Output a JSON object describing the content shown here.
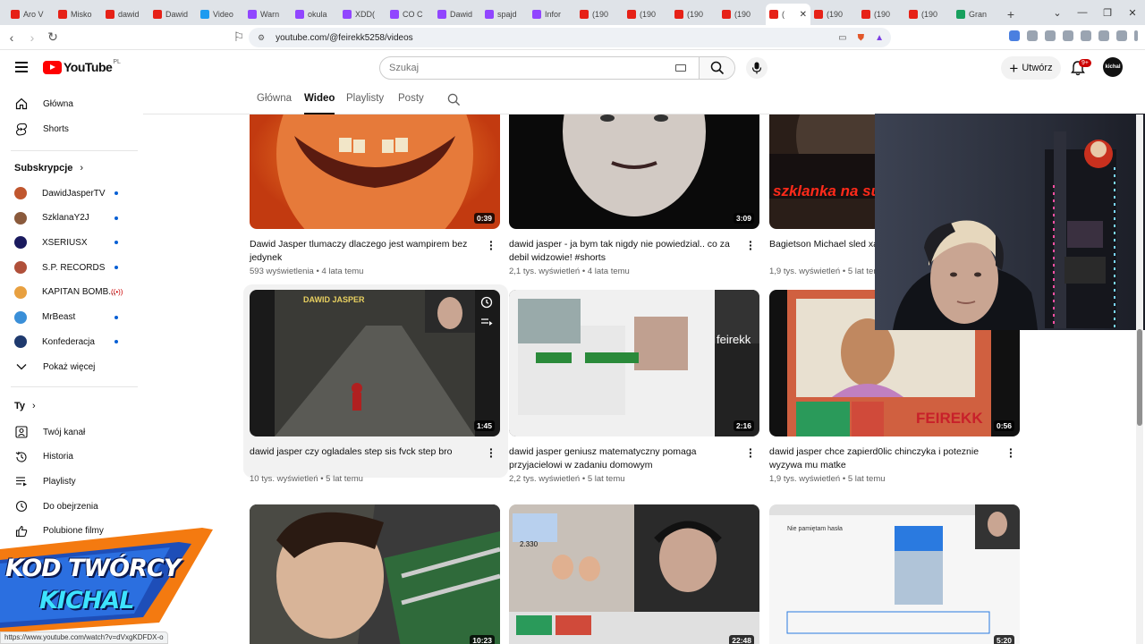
{
  "browser": {
    "tabs": [
      {
        "label": "Aro V",
        "color": "#e62117"
      },
      {
        "label": "Misko",
        "color": "#e62117"
      },
      {
        "label": "dawid",
        "color": "#e62117"
      },
      {
        "label": "Dawid",
        "color": "#e62117"
      },
      {
        "label": "Video",
        "color": "#1d9bf0"
      },
      {
        "label": "Warn",
        "color": "#9146ff"
      },
      {
        "label": "okula",
        "color": "#9146ff"
      },
      {
        "label": "XDD(",
        "color": "#9146ff"
      },
      {
        "label": "CO C",
        "color": "#9146ff"
      },
      {
        "label": "Dawid",
        "color": "#9146ff"
      },
      {
        "label": "spajd",
        "color": "#9146ff"
      },
      {
        "label": "Infor",
        "color": "#9146ff"
      },
      {
        "label": "(190",
        "color": "#e62117"
      },
      {
        "label": "(190",
        "color": "#e62117"
      },
      {
        "label": "(190",
        "color": "#e62117"
      },
      {
        "label": "(190",
        "color": "#e62117"
      },
      {
        "label": "(",
        "color": "#e62117",
        "active": true
      },
      {
        "label": "(190",
        "color": "#e62117"
      },
      {
        "label": "(190",
        "color": "#e62117"
      },
      {
        "label": "(190",
        "color": "#e62117"
      },
      {
        "label": "Gran",
        "color": "#18a05e"
      }
    ],
    "url": "youtube.com/@feirekk5258/videos",
    "status_url": "https://www.youtube.com/watch?v=dVxgKDFDX-o"
  },
  "masthead": {
    "logo_text": "YouTube",
    "country_code": "PL",
    "search_placeholder": "Szukaj",
    "create_label": "Utwórz",
    "notifications_badge": "9+",
    "avatar_label": "kichal"
  },
  "sidebar": {
    "main": [
      {
        "label": "Główna",
        "icon": "home-icon"
      },
      {
        "label": "Shorts",
        "icon": "shorts-icon"
      }
    ],
    "subscriptions_heading": "Subskrypcje",
    "subscriptions": [
      {
        "label": "DawidJasperTV",
        "color": "#c0562e",
        "indicator": "dot"
      },
      {
        "label": "SzklanaY2J",
        "color": "#8a5a3c",
        "indicator": "dot"
      },
      {
        "label": "XSERIUSX",
        "color": "#1a1a5e",
        "indicator": "dot"
      },
      {
        "label": "S.P. RECORDS",
        "color": "#b0503a",
        "indicator": "dot"
      },
      {
        "label": "KAPITAN BOMB...",
        "color": "#e8a040",
        "indicator": "live"
      },
      {
        "label": "MrBeast",
        "color": "#3a8fd8",
        "indicator": "dot"
      },
      {
        "label": "Konfederacja",
        "color": "#1f3a6e",
        "indicator": "dot"
      }
    ],
    "show_more": "Pokaż więcej",
    "you_heading": "Ty",
    "you_items": [
      {
        "label": "Twój kanał",
        "icon": "user-icon"
      },
      {
        "label": "Historia",
        "icon": "history-icon"
      },
      {
        "label": "Playlisty",
        "icon": "playlist-icon"
      },
      {
        "label": "Do obejrzenia",
        "icon": "clock-icon"
      },
      {
        "label": "Polubione filmy",
        "icon": "like-icon"
      }
    ]
  },
  "channel_tabs": [
    {
      "label": "Główna"
    },
    {
      "label": "Wideo",
      "selected": true
    },
    {
      "label": "Playlisty"
    },
    {
      "label": "Posty"
    }
  ],
  "videos": [
    {
      "title": "Dawid Jasper tlumaczy dlaczego jest wampirem bez jedynek",
      "views": "593 wyświetlenia",
      "age": "4 lata temu",
      "duration": "0:39"
    },
    {
      "title": "dawid jasper - ja bym tak nigdy nie powiedzial.. co za debil widzowie! #shorts",
      "views": "2,1 tys. wyświetleń",
      "age": "4 lata temu",
      "duration": "3:09"
    },
    {
      "title": "Bagietson Michael  sled xayoo, szklanka na svke,",
      "views": "1,9 tys. wyświetleń",
      "age": "5 lat ter",
      "duration": "",
      "thumb_text": "szklanka na su"
    },
    {
      "title": "dawid jasper czy ogladales step sis fvck step bro",
      "views": "10 tys. wyświetleń",
      "age": "5 lat temu",
      "duration": "1:45",
      "thumb_text": "DAWID JASPER"
    },
    {
      "title": "dawid jasper geniusz matematyczny pomaga przyjacielowi w zadaniu domowym",
      "views": "2,2 tys. wyświetleń",
      "age": "5 lat temu",
      "duration": "2:16",
      "thumb_text": "feirekk"
    },
    {
      "title": "dawid jasper chce zapierd0lic chinczyka i poteznie wyzywa mu matke",
      "views": "1,9 tys. wyświetleń",
      "age": "5 lat temu",
      "duration": "0:56",
      "thumb_text": "FEIREKK"
    },
    {
      "title": "",
      "views": "",
      "age": "",
      "duration": "10:23"
    },
    {
      "title": "",
      "views": "",
      "age": "",
      "duration": "22:48",
      "thumb_text": "2.330"
    },
    {
      "title": "",
      "views": "",
      "age": "",
      "duration": "5:20",
      "thumb_text": "Nie pamiętam hasła"
    }
  ],
  "overlay": {
    "banner_line1": "KOD TWÓRCY",
    "banner_line2": "KICHAL"
  }
}
